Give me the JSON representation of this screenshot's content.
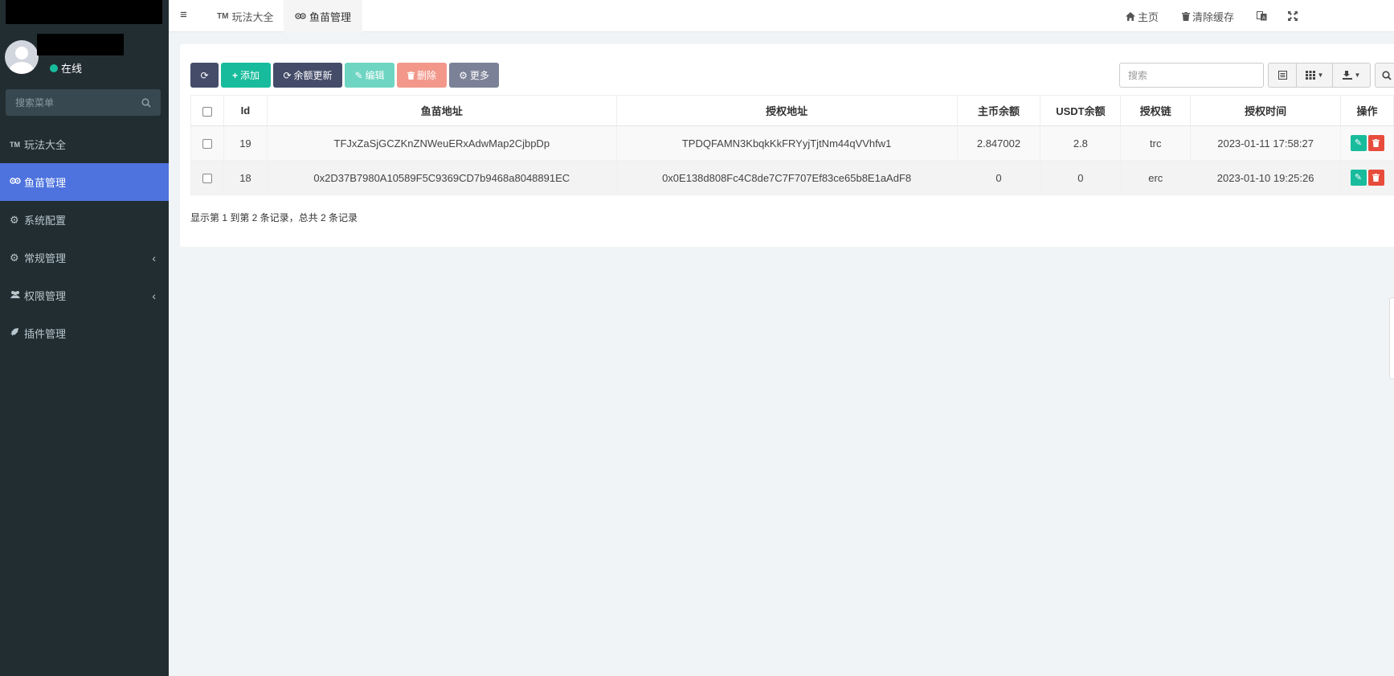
{
  "sidebar": {
    "status": "在线",
    "search_placeholder": "搜索菜单",
    "items": [
      {
        "label": "玩法大全",
        "icon": "tm-icon",
        "glyph": "TM"
      },
      {
        "label": "鱼苗管理",
        "icon": "tripadvisor-icon",
        "glyph": "∞"
      },
      {
        "label": "系统配置",
        "icon": "gear-icon",
        "glyph": "⚙"
      },
      {
        "label": "常规管理",
        "icon": "cogs-icon",
        "glyph": "⚙"
      },
      {
        "label": "权限管理",
        "icon": "users-icon",
        "glyph": "👥"
      },
      {
        "label": "插件管理",
        "icon": "rocket-icon",
        "glyph": "🚀"
      }
    ]
  },
  "topbar": {
    "tabs": [
      {
        "label": "玩法大全",
        "prefix": "TM"
      },
      {
        "label": "鱼苗管理",
        "prefix": "∞"
      }
    ],
    "home": "主页",
    "clear_cache": "清除缓存"
  },
  "toolbar": {
    "add": "添加",
    "balance_update": "余额更新",
    "edit": "编辑",
    "delete": "删除",
    "more": "更多",
    "search_placeholder": "搜索"
  },
  "table": {
    "headers": [
      "Id",
      "鱼苗地址",
      "授权地址",
      "主币余额",
      "USDT余额",
      "授权链",
      "授权时间",
      "操作"
    ],
    "rows": [
      {
        "id": "19",
        "fish_address": "TFJxZaSjGCZKnZNWeuERxAdwMap2CjbpDp",
        "auth_address": "TPDQFAMN3KbqkKkFRYyjTjtNm44qVVhfw1",
        "main_balance": "2.847002",
        "usdt_balance": "2.8",
        "chain": "trc",
        "auth_time": "2023-01-11 17:58:27"
      },
      {
        "id": "18",
        "fish_address": "0x2D37B7980A10589F5C9369CD7b9468a8048891EC",
        "auth_address": "0x0E138d808Fc4C8de7C7F707Ef83ce65b8E1aAdF8",
        "main_balance": "0",
        "usdt_balance": "0",
        "chain": "erc",
        "auth_time": "2023-01-10 19:25:26"
      }
    ]
  },
  "pagination": {
    "text": "显示第 1 到第 2 条记录，总共 2 条记录"
  },
  "colors": {
    "sidebar_bg": "#222d32",
    "active": "#4e73df",
    "success": "#18bc9c",
    "danger": "#e74c3c",
    "primary_dark": "#444c69"
  }
}
